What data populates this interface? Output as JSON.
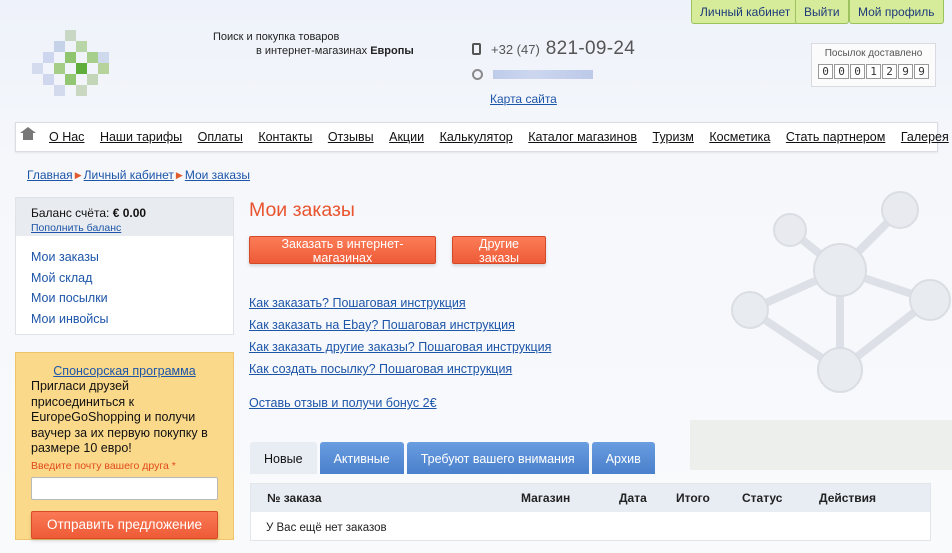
{
  "header": {
    "tagline_line1": "Поиск и покупка товаров",
    "tagline_line2_prefix": "в интернет-магазинах ",
    "tagline_line2_bold": "Европы",
    "phone_code": "+32 (47)",
    "phone_number": "821-09-24",
    "sitemap_link": "Карта сайта",
    "top_buttons": [
      "Личный кабинет",
      "Выйти",
      "Мой профиль"
    ],
    "delivered_label": "Посылок доставлено",
    "delivered_digits": [
      "0",
      "0",
      "0",
      "1",
      "2",
      "9",
      "9"
    ]
  },
  "nav": {
    "items": [
      "О Нас",
      "Наши тарифы",
      "Оплаты",
      "Контакты",
      "Отзывы",
      "Акции",
      "Калькулятор",
      "Каталог магазинов",
      "Туризм",
      "Косметика",
      "Стать партнером",
      "Галерея"
    ]
  },
  "breadcrumb": [
    "Главная",
    "Личный кабинет",
    "Мои заказы"
  ],
  "sidebar": {
    "balance_label": "Баланс счёта:",
    "balance_value": "€ 0.00",
    "topup_link": "Пополнить баланс",
    "links": [
      "Мои заказы",
      "Мой склад",
      "Мои посылки",
      "Мои инвойсы"
    ],
    "sponsor": {
      "title": "Спонсорская программа",
      "text": "Пригласи друзей присоединиться к EuropeGoShopping и получи ваучер за их первую покупку в размере 10 евро!",
      "hint": "Введите почту вашего друга *",
      "input_value": "",
      "submit": "Отправить предложение"
    }
  },
  "main": {
    "title": "Мои заказы",
    "buttons": [
      "Заказать в интернет-магазинах",
      "Другие заказы"
    ],
    "guides": [
      "Как заказать? Пошаговая инструкция",
      "Как заказать на Ebay? Пошаговая инструкция",
      "Как заказать другие заказы? Пошаговая инструкция",
      "Как создать посылку? Пошаговая инструкция"
    ],
    "review_link": "Оставь отзыв и получи бонус 2€",
    "tabs": [
      "Новые",
      "Активные",
      "Требуют вашего внимания",
      "Архив"
    ],
    "active_tab": "Новые",
    "columns": [
      "№ заказа",
      "Магазин",
      "Дата",
      "Итого",
      "Статус",
      "Действия"
    ],
    "empty_text": "У Вас ещё нет заказов"
  },
  "colors": {
    "accent_orange": "#ee5b37",
    "link_blue": "#1d55a8",
    "tab_blue": "#4a80cc",
    "topbar_green": "#d6ec9a",
    "sponsor_bg": "#fbd98a"
  }
}
